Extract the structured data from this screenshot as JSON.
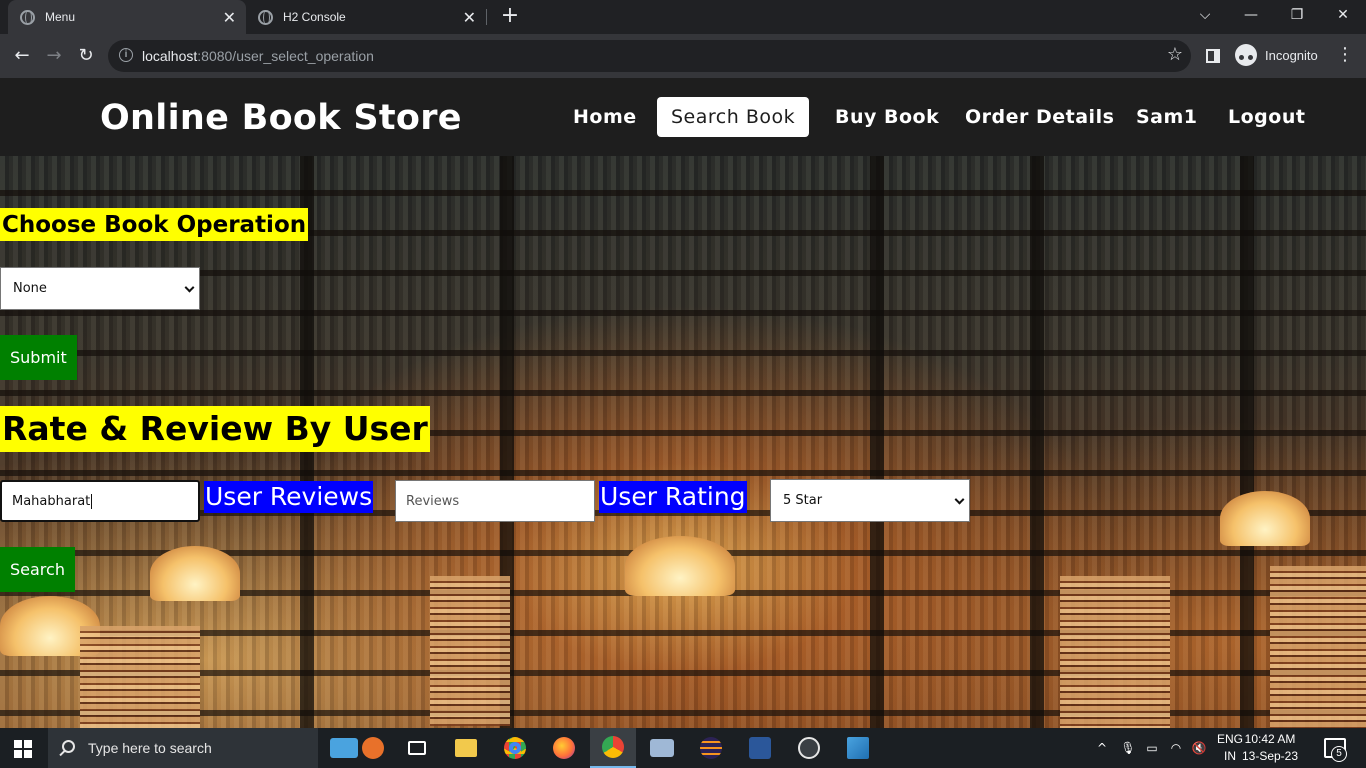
{
  "browser": {
    "tabs": [
      {
        "title": "Menu",
        "active": true
      },
      {
        "title": "H2 Console",
        "active": false
      }
    ],
    "new_tab_symbol": "+",
    "close_symbol": "✕",
    "url_host": "localhost",
    "url_rest": ":8080/user_select_operation",
    "profile_label": "Incognito",
    "window_controls": {
      "tab_search": "⌵",
      "minimize": "—",
      "restore": "❐",
      "close": "✕"
    },
    "nav_icons": {
      "back": "←",
      "forward": "→",
      "reload": "↻",
      "bookmark": "☆",
      "menu": "⋮"
    }
  },
  "site": {
    "title": "Online Book Store",
    "nav": [
      {
        "label": "Home",
        "active": false
      },
      {
        "label": "Search Book",
        "active": true
      },
      {
        "label": "Buy Book",
        "active": false
      },
      {
        "label": "Order Details",
        "active": false
      },
      {
        "label": "Sam1",
        "active": false
      },
      {
        "label": "Logout",
        "active": false
      }
    ]
  },
  "operation_form": {
    "heading": "Choose Book Operation",
    "select_value": "None",
    "submit_label": "Submit"
  },
  "review_form": {
    "heading": "Rate & Review By User",
    "book_input_value": "Mahabharat",
    "reviews_label": "User Reviews",
    "reviews_placeholder": "Reviews",
    "rating_label": "User Rating",
    "rating_select_value": "5 Star",
    "search_label": "Search"
  },
  "taskbar": {
    "search_placeholder": "Type here to search",
    "apps": [
      "widgets-icon",
      "task-view-icon",
      "file-explorer-icon",
      "chrome-icon",
      "firefox-icon",
      "chrome-incognito-icon",
      "network-app-icon",
      "eclipse-icon",
      "word-icon",
      "obs-icon",
      "photos-icon"
    ],
    "language_line1": "ENG",
    "language_line2": "IN",
    "time": "10:42 AM",
    "date": "13-Sep-23",
    "notification_count": "5",
    "tray_chevron": "^"
  },
  "colors": {
    "heading_bg": "#ffff00",
    "label_bg": "#0000ff",
    "button_green": "#008000",
    "header_bg": "#1e1e1e"
  }
}
